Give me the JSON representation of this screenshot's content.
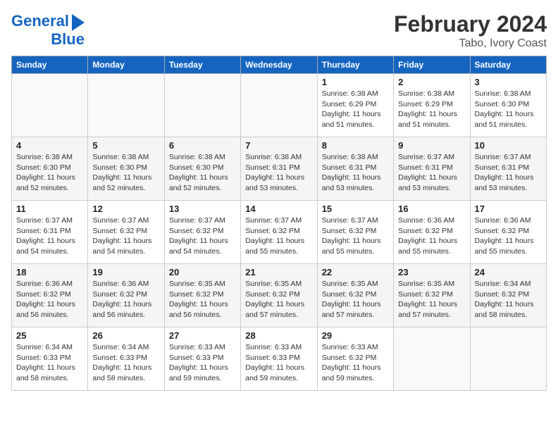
{
  "header": {
    "logo_line1": "General",
    "logo_line2": "Blue",
    "title": "February 2024",
    "subtitle": "Tabo, Ivory Coast"
  },
  "days_of_week": [
    "Sunday",
    "Monday",
    "Tuesday",
    "Wednesday",
    "Thursday",
    "Friday",
    "Saturday"
  ],
  "weeks": [
    [
      {
        "day": "",
        "info": ""
      },
      {
        "day": "",
        "info": ""
      },
      {
        "day": "",
        "info": ""
      },
      {
        "day": "",
        "info": ""
      },
      {
        "day": "1",
        "info": "Sunrise: 6:38 AM\nSunset: 6:29 PM\nDaylight: 11 hours\nand 51 minutes."
      },
      {
        "day": "2",
        "info": "Sunrise: 6:38 AM\nSunset: 6:29 PM\nDaylight: 11 hours\nand 51 minutes."
      },
      {
        "day": "3",
        "info": "Sunrise: 6:38 AM\nSunset: 6:30 PM\nDaylight: 11 hours\nand 51 minutes."
      }
    ],
    [
      {
        "day": "4",
        "info": "Sunrise: 6:38 AM\nSunset: 6:30 PM\nDaylight: 11 hours\nand 52 minutes."
      },
      {
        "day": "5",
        "info": "Sunrise: 6:38 AM\nSunset: 6:30 PM\nDaylight: 11 hours\nand 52 minutes."
      },
      {
        "day": "6",
        "info": "Sunrise: 6:38 AM\nSunset: 6:30 PM\nDaylight: 11 hours\nand 52 minutes."
      },
      {
        "day": "7",
        "info": "Sunrise: 6:38 AM\nSunset: 6:31 PM\nDaylight: 11 hours\nand 53 minutes."
      },
      {
        "day": "8",
        "info": "Sunrise: 6:38 AM\nSunset: 6:31 PM\nDaylight: 11 hours\nand 53 minutes."
      },
      {
        "day": "9",
        "info": "Sunrise: 6:37 AM\nSunset: 6:31 PM\nDaylight: 11 hours\nand 53 minutes."
      },
      {
        "day": "10",
        "info": "Sunrise: 6:37 AM\nSunset: 6:31 PM\nDaylight: 11 hours\nand 53 minutes."
      }
    ],
    [
      {
        "day": "11",
        "info": "Sunrise: 6:37 AM\nSunset: 6:31 PM\nDaylight: 11 hours\nand 54 minutes."
      },
      {
        "day": "12",
        "info": "Sunrise: 6:37 AM\nSunset: 6:32 PM\nDaylight: 11 hours\nand 54 minutes."
      },
      {
        "day": "13",
        "info": "Sunrise: 6:37 AM\nSunset: 6:32 PM\nDaylight: 11 hours\nand 54 minutes."
      },
      {
        "day": "14",
        "info": "Sunrise: 6:37 AM\nSunset: 6:32 PM\nDaylight: 11 hours\nand 55 minutes."
      },
      {
        "day": "15",
        "info": "Sunrise: 6:37 AM\nSunset: 6:32 PM\nDaylight: 11 hours\nand 55 minutes."
      },
      {
        "day": "16",
        "info": "Sunrise: 6:36 AM\nSunset: 6:32 PM\nDaylight: 11 hours\nand 55 minutes."
      },
      {
        "day": "17",
        "info": "Sunrise: 6:36 AM\nSunset: 6:32 PM\nDaylight: 11 hours\nand 55 minutes."
      }
    ],
    [
      {
        "day": "18",
        "info": "Sunrise: 6:36 AM\nSunset: 6:32 PM\nDaylight: 11 hours\nand 56 minutes."
      },
      {
        "day": "19",
        "info": "Sunrise: 6:36 AM\nSunset: 6:32 PM\nDaylight: 11 hours\nand 56 minutes."
      },
      {
        "day": "20",
        "info": "Sunrise: 6:35 AM\nSunset: 6:32 PM\nDaylight: 11 hours\nand 56 minutes."
      },
      {
        "day": "21",
        "info": "Sunrise: 6:35 AM\nSunset: 6:32 PM\nDaylight: 11 hours\nand 57 minutes."
      },
      {
        "day": "22",
        "info": "Sunrise: 6:35 AM\nSunset: 6:32 PM\nDaylight: 11 hours\nand 57 minutes."
      },
      {
        "day": "23",
        "info": "Sunrise: 6:35 AM\nSunset: 6:32 PM\nDaylight: 11 hours\nand 57 minutes."
      },
      {
        "day": "24",
        "info": "Sunrise: 6:34 AM\nSunset: 6:32 PM\nDaylight: 11 hours\nand 58 minutes."
      }
    ],
    [
      {
        "day": "25",
        "info": "Sunrise: 6:34 AM\nSunset: 6:33 PM\nDaylight: 11 hours\nand 58 minutes."
      },
      {
        "day": "26",
        "info": "Sunrise: 6:34 AM\nSunset: 6:33 PM\nDaylight: 11 hours\nand 58 minutes."
      },
      {
        "day": "27",
        "info": "Sunrise: 6:33 AM\nSunset: 6:33 PM\nDaylight: 11 hours\nand 59 minutes."
      },
      {
        "day": "28",
        "info": "Sunrise: 6:33 AM\nSunset: 6:33 PM\nDaylight: 11 hours\nand 59 minutes."
      },
      {
        "day": "29",
        "info": "Sunrise: 6:33 AM\nSunset: 6:32 PM\nDaylight: 11 hours\nand 59 minutes."
      },
      {
        "day": "",
        "info": ""
      },
      {
        "day": "",
        "info": ""
      }
    ]
  ]
}
